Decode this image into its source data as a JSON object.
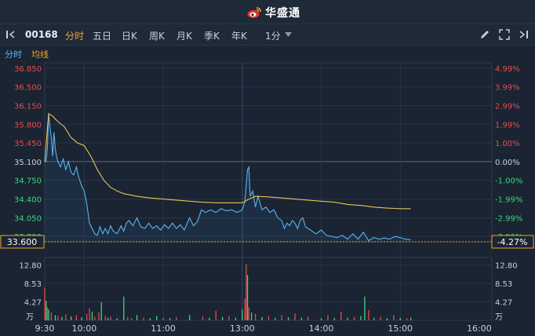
{
  "brand": {
    "name": "华盛通"
  },
  "toolbar": {
    "stock_code": "00168",
    "tabs": [
      "分时",
      "五日",
      "日K",
      "周K",
      "月K",
      "季K",
      "年K"
    ],
    "active_tab": "分时",
    "interval": "1分"
  },
  "legend": {
    "items": [
      "分时",
      "均线"
    ]
  },
  "colors": {
    "background": "#1a2433",
    "price_line": "#5ab4f0",
    "avg_line": "#e8c45a",
    "up": "#e84a4a",
    "down": "#3ed67a",
    "accent": "#f5a623"
  },
  "chart_data": {
    "type": "line",
    "reference_price": 35.1,
    "current_price": "33.600",
    "current_change": "-4.27%",
    "price_ticks": [
      "36.850",
      "36.500",
      "36.150",
      "35.800",
      "35.450",
      "35.100",
      "34.750",
      "34.400",
      "34.050",
      "33.700"
    ],
    "pct_ticks": [
      "4.99%",
      "3.99%",
      "2.99%",
      "1.99%",
      "1.00%",
      "0.00%",
      "-1.00%",
      "-1.99%",
      "-2.99%",
      "-3.99%"
    ],
    "volume_ticks": [
      "12.80",
      "8.53",
      "4.27"
    ],
    "volume_unit": "万",
    "time_ticks": [
      "9:30",
      "10:00",
      "11:00",
      "13:00",
      "14:00",
      "15:00",
      "16:00"
    ],
    "ylim": [
      33.6,
      36.95
    ],
    "price_series": [
      [
        0,
        35.1
      ],
      [
        1,
        35.1
      ],
      [
        2,
        35.35
      ],
      [
        3,
        36.0
      ],
      [
        4,
        35.75
      ],
      [
        5,
        35.55
      ],
      [
        6,
        35.2
      ],
      [
        7,
        35.65
      ],
      [
        8,
        35.35
      ],
      [
        9,
        35.2
      ],
      [
        10,
        35.1
      ],
      [
        12,
        35.0
      ],
      [
        14,
        35.15
      ],
      [
        16,
        34.95
      ],
      [
        18,
        35.1
      ],
      [
        20,
        34.9
      ],
      [
        22,
        34.85
      ],
      [
        24,
        35.0
      ],
      [
        26,
        34.8
      ],
      [
        28,
        34.65
      ],
      [
        30,
        34.55
      ],
      [
        32,
        34.3
      ],
      [
        34,
        33.95
      ],
      [
        36,
        33.85
      ],
      [
        38,
        33.75
      ],
      [
        40,
        33.72
      ],
      [
        42,
        33.88
      ],
      [
        44,
        33.75
      ],
      [
        46,
        33.85
      ],
      [
        48,
        33.75
      ],
      [
        50,
        33.9
      ],
      [
        52,
        33.8
      ],
      [
        55,
        33.75
      ],
      [
        58,
        33.9
      ],
      [
        60,
        33.8
      ],
      [
        62,
        33.95
      ],
      [
        64,
        34.0
      ],
      [
        67,
        33.9
      ],
      [
        70,
        34.05
      ],
      [
        73,
        33.88
      ],
      [
        76,
        33.85
      ],
      [
        79,
        33.95
      ],
      [
        82,
        33.85
      ],
      [
        85,
        33.9
      ],
      [
        88,
        33.82
      ],
      [
        91,
        33.92
      ],
      [
        94,
        33.85
      ],
      [
        97,
        33.95
      ],
      [
        100,
        33.85
      ],
      [
        103,
        33.92
      ],
      [
        106,
        33.82
      ],
      [
        110,
        34.05
      ],
      [
        113,
        33.9
      ],
      [
        116,
        33.98
      ],
      [
        119,
        34.2
      ],
      [
        122,
        34.15
      ],
      [
        126,
        34.2
      ],
      [
        130,
        34.15
      ],
      [
        134,
        34.22
      ],
      [
        138,
        34.18
      ],
      [
        142,
        34.2
      ],
      [
        146,
        34.15
      ],
      [
        150,
        34.2
      ],
      [
        152,
        34.35
      ],
      [
        154,
        34.95
      ],
      [
        155,
        35.0
      ],
      [
        156,
        34.45
      ],
      [
        158,
        34.55
      ],
      [
        160,
        34.25
      ],
      [
        162,
        34.45
      ],
      [
        165,
        34.2
      ],
      [
        168,
        34.25
      ],
      [
        171,
        34.15
      ],
      [
        174,
        34.2
      ],
      [
        177,
        34.05
      ],
      [
        180,
        34.0
      ],
      [
        182,
        33.85
      ],
      [
        184,
        33.95
      ],
      [
        186,
        33.9
      ],
      [
        188,
        34.0
      ],
      [
        190,
        33.95
      ],
      [
        192,
        33.85
      ],
      [
        194,
        34.0
      ],
      [
        196,
        34.05
      ],
      [
        198,
        33.88
      ],
      [
        200,
        33.85
      ],
      [
        203,
        33.8
      ],
      [
        206,
        33.75
      ],
      [
        210,
        33.82
      ],
      [
        214,
        33.72
      ],
      [
        218,
        33.7
      ],
      [
        222,
        33.68
      ],
      [
        226,
        33.72
      ],
      [
        230,
        33.65
      ],
      [
        234,
        33.75
      ],
      [
        238,
        33.65
      ],
      [
        242,
        33.78
      ],
      [
        246,
        33.62
      ],
      [
        250,
        33.68
      ],
      [
        254,
        33.65
      ],
      [
        258,
        33.67
      ],
      [
        262,
        33.65
      ],
      [
        266,
        33.7
      ],
      [
        270,
        33.68
      ],
      [
        274,
        33.65
      ],
      [
        278,
        33.64
      ]
    ],
    "avg_series": [
      [
        0,
        35.1
      ],
      [
        3,
        36.0
      ],
      [
        6,
        35.95
      ],
      [
        10,
        35.85
      ],
      [
        15,
        35.75
      ],
      [
        20,
        35.55
      ],
      [
        25,
        35.45
      ],
      [
        30,
        35.4
      ],
      [
        35,
        35.2
      ],
      [
        40,
        34.95
      ],
      [
        45,
        34.75
      ],
      [
        50,
        34.62
      ],
      [
        55,
        34.55
      ],
      [
        60,
        34.5
      ],
      [
        70,
        34.45
      ],
      [
        80,
        34.42
      ],
      [
        90,
        34.4
      ],
      [
        100,
        34.38
      ],
      [
        110,
        34.36
      ],
      [
        120,
        34.34
      ],
      [
        130,
        34.33
      ],
      [
        140,
        34.33
      ],
      [
        150,
        34.33
      ],
      [
        155,
        34.4
      ],
      [
        160,
        34.45
      ],
      [
        170,
        34.44
      ],
      [
        180,
        34.42
      ],
      [
        190,
        34.4
      ],
      [
        200,
        34.38
      ],
      [
        210,
        34.36
      ],
      [
        220,
        34.34
      ],
      [
        230,
        34.3
      ],
      [
        240,
        34.28
      ],
      [
        250,
        34.25
      ],
      [
        260,
        34.23
      ],
      [
        270,
        34.22
      ],
      [
        278,
        34.22
      ]
    ],
    "volume_bars": [
      [
        0,
        7.5,
        "up"
      ],
      [
        1,
        4.5,
        "down"
      ],
      [
        2,
        3.0,
        "up"
      ],
      [
        3,
        2.5,
        "down"
      ],
      [
        5,
        1.8,
        "up"
      ],
      [
        8,
        1.2,
        "down"
      ],
      [
        10,
        1.0,
        "up"
      ],
      [
        13,
        0.8,
        "down"
      ],
      [
        16,
        1.4,
        "up"
      ],
      [
        20,
        0.9,
        "down"
      ],
      [
        24,
        1.2,
        "up"
      ],
      [
        28,
        0.7,
        "down"
      ],
      [
        32,
        1.5,
        "up"
      ],
      [
        34,
        2.8,
        "up"
      ],
      [
        36,
        2.0,
        "down"
      ],
      [
        38,
        0.8,
        "up"
      ],
      [
        41,
        1.8,
        "up"
      ],
      [
        43,
        4.2,
        "down"
      ],
      [
        46,
        1.0,
        "up"
      ],
      [
        48,
        0.6,
        "down"
      ],
      [
        50,
        0.8,
        "up"
      ],
      [
        55,
        0.5,
        "down"
      ],
      [
        60,
        5.5,
        "down"
      ],
      [
        63,
        0.8,
        "up"
      ],
      [
        66,
        0.5,
        "up"
      ],
      [
        70,
        1.2,
        "down"
      ],
      [
        75,
        0.6,
        "up"
      ],
      [
        80,
        0.5,
        "down"
      ],
      [
        85,
        1.0,
        "down"
      ],
      [
        90,
        0.6,
        "up"
      ],
      [
        95,
        0.5,
        "down"
      ],
      [
        100,
        0.8,
        "up"
      ],
      [
        110,
        1.2,
        "down"
      ],
      [
        120,
        0.9,
        "up"
      ],
      [
        125,
        0.6,
        "down"
      ],
      [
        130,
        2.2,
        "up"
      ],
      [
        135,
        0.8,
        "down"
      ],
      [
        140,
        1.0,
        "up"
      ],
      [
        145,
        0.6,
        "down"
      ],
      [
        150,
        2.5,
        "down"
      ],
      [
        152,
        5.0,
        "up"
      ],
      [
        153,
        13.0,
        "up"
      ],
      [
        154,
        10.5,
        "down"
      ],
      [
        155,
        3.0,
        "up"
      ],
      [
        157,
        1.8,
        "down"
      ],
      [
        160,
        1.5,
        "up"
      ],
      [
        165,
        0.8,
        "down"
      ],
      [
        170,
        1.0,
        "up"
      ],
      [
        175,
        0.6,
        "down"
      ],
      [
        180,
        1.2,
        "up"
      ],
      [
        185,
        0.7,
        "down"
      ],
      [
        190,
        1.6,
        "up"
      ],
      [
        195,
        0.6,
        "down"
      ],
      [
        200,
        0.9,
        "up"
      ],
      [
        210,
        0.5,
        "down"
      ],
      [
        215,
        1.2,
        "up"
      ],
      [
        220,
        0.6,
        "down"
      ],
      [
        225,
        2.0,
        "up"
      ],
      [
        230,
        0.6,
        "down"
      ],
      [
        235,
        0.8,
        "up"
      ],
      [
        240,
        1.0,
        "down"
      ],
      [
        243,
        5.5,
        "down"
      ],
      [
        246,
        2.4,
        "up"
      ],
      [
        250,
        0.6,
        "down"
      ],
      [
        255,
        0.8,
        "up"
      ],
      [
        260,
        0.5,
        "down"
      ],
      [
        265,
        1.2,
        "up"
      ],
      [
        270,
        0.6,
        "down"
      ],
      [
        275,
        0.5,
        "up"
      ],
      [
        278,
        0.6,
        "down"
      ]
    ]
  }
}
